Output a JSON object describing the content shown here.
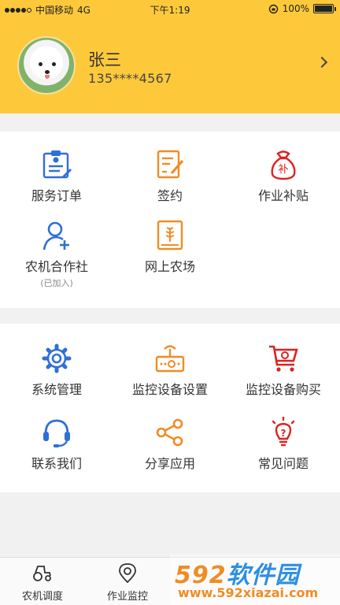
{
  "status": {
    "carrier": "中国移动",
    "network": "4G",
    "time": "下午1:19",
    "battery": "100%",
    "battery_level": 1.0
  },
  "profile": {
    "name": "张三",
    "phone": "135****4567"
  },
  "services": [
    {
      "label": "服务订单",
      "icon": "clipboard-icon"
    },
    {
      "label": "签约",
      "icon": "contract-pen-icon"
    },
    {
      "label": "作业补贴",
      "icon": "money-bag-icon",
      "badge": "补"
    },
    {
      "label": "农机合作社",
      "sub": "(已加入)",
      "icon": "add-user-icon"
    },
    {
      "label": "网上农场",
      "icon": "wheat-book-icon"
    }
  ],
  "settings": [
    {
      "label": "系统管理",
      "icon": "gear-icon"
    },
    {
      "label": "监控设备设置",
      "icon": "router-icon"
    },
    {
      "label": "监控设备购买",
      "icon": "cart-camera-icon"
    },
    {
      "label": "联系我们",
      "icon": "headset-icon"
    },
    {
      "label": "分享应用",
      "icon": "share-icon"
    },
    {
      "label": "常见问题",
      "icon": "lightbulb-question-icon"
    }
  ],
  "tabbar": [
    {
      "label": "农机调度",
      "icon": "tractor-icon"
    },
    {
      "label": "作业监控",
      "icon": "location-camera-icon"
    }
  ],
  "watermark": {
    "brand_num": "592",
    "brand_text": "软件园",
    "url": "www.592xiazai.com"
  },
  "colors": {
    "accent": "#fdc93a",
    "blue": "#2f6fd8",
    "orange": "#f08c24",
    "red": "#e02020"
  }
}
